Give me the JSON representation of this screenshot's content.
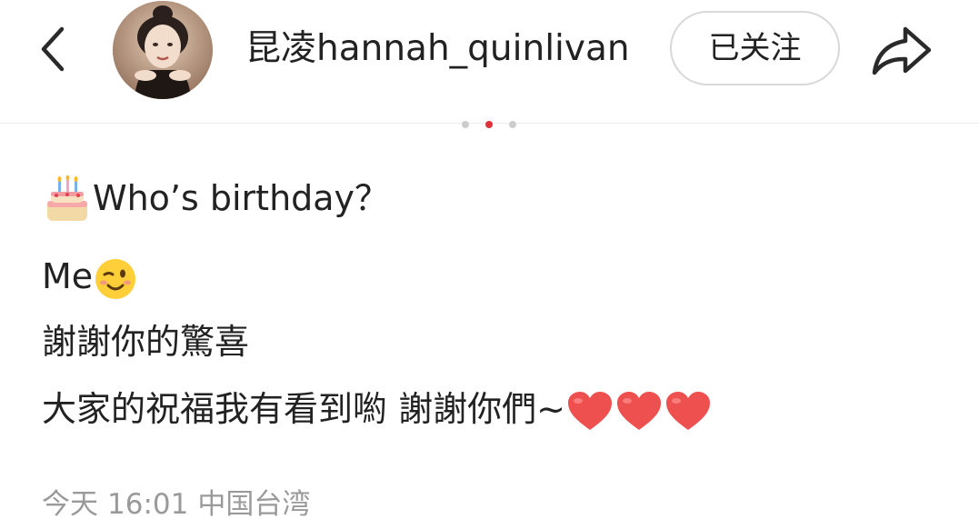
{
  "header": {
    "back_icon": "chevron-left-icon",
    "username": "昆凌hannah_quinlivan",
    "follow_label": "已关注",
    "share_icon": "share-arrow-icon"
  },
  "pager": {
    "count": 3,
    "active_index": 1
  },
  "post": {
    "line1_emoji": "birthday-cake",
    "line1_text": "Who’s birthday？",
    "line2_text": "Me",
    "line2_emoji": "winking-face",
    "line3_text": "謝謝你的驚喜",
    "line4_text": "大家的祝福我有看到喲 謝謝你們~",
    "line4_emoji": "red-heart ×3"
  },
  "meta": {
    "date": "今天",
    "time": "16:01",
    "location": "中国台湾"
  },
  "colors": {
    "accent_active_dot": "#e0303a",
    "inactive_dot": "#cccccc",
    "meta_text": "#9a9a9a",
    "border": "#d8d8d8"
  }
}
